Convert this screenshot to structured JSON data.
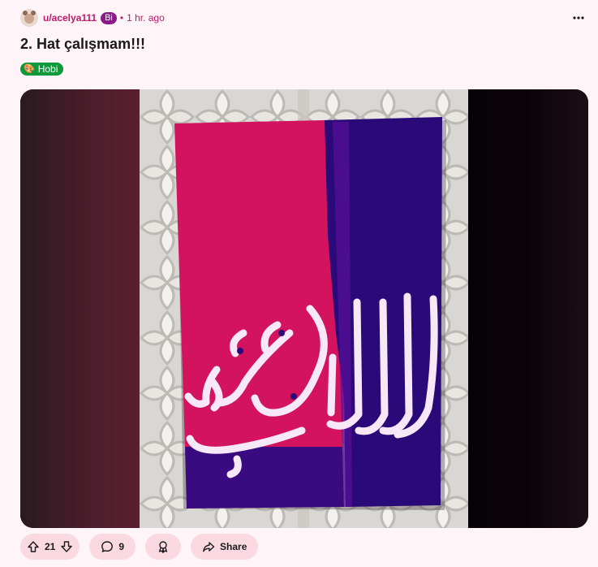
{
  "post": {
    "author": "u/acelya111",
    "author_flair": "Bi",
    "separator": "•",
    "time": "1 hr. ago",
    "title": "2. Hat çalışmam!!!",
    "flair_emoji": "🎨",
    "flair": "Hobi"
  },
  "actions": {
    "votes": "21",
    "comments": "9",
    "share": "Share"
  },
  "icons": [
    "avatar",
    "more-horizontal-icon",
    "upvote-icon",
    "downvote-icon",
    "comment-icon",
    "award-icon",
    "share-icon"
  ],
  "colors": {
    "accent": "#c0186c",
    "bi_flair": "#8a1a87",
    "hobi_flair": "#0e9a3b",
    "pill_bg": "#fbd9e3",
    "canvas_pink": "#d4135e",
    "canvas_purple": "#2a0a78"
  }
}
